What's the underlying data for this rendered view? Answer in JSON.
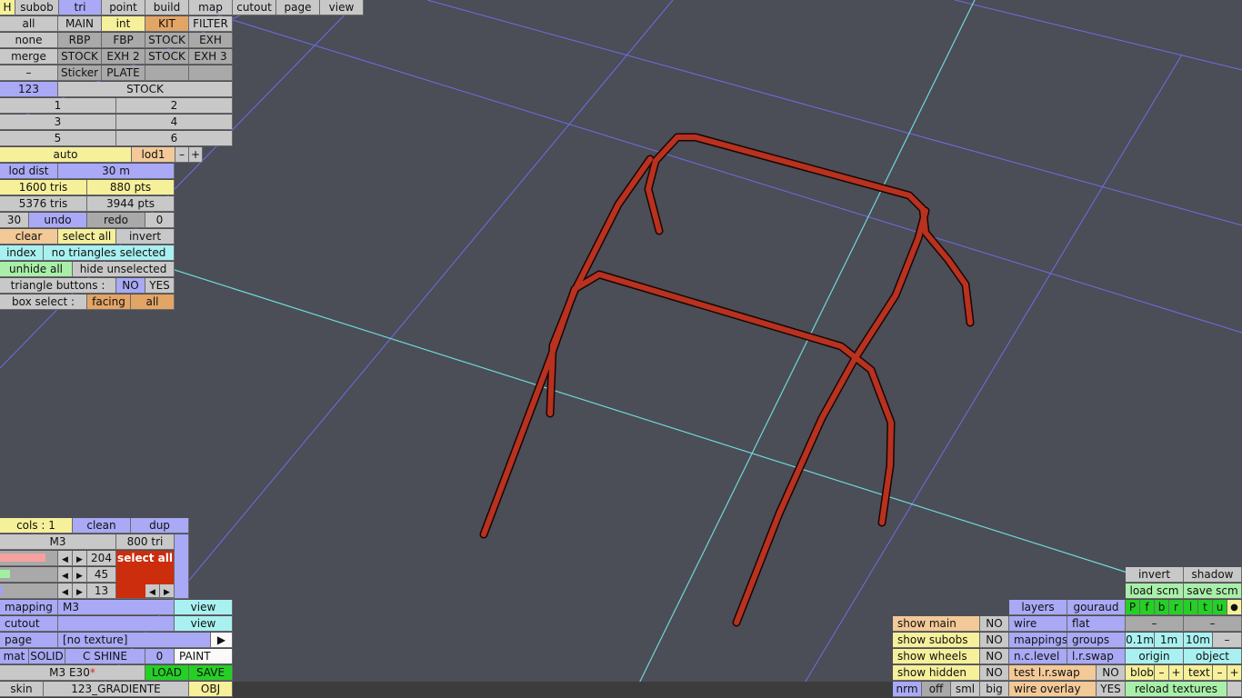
{
  "top_menu": {
    "h": "H",
    "subob": "subob",
    "tri": "tri",
    "point": "point",
    "build": "build",
    "map": "map",
    "cutout": "cutout",
    "page": "page",
    "view": "view"
  },
  "parts": {
    "all": "all",
    "none": "none",
    "merge": "merge",
    "dash": "–",
    "row1": [
      "MAIN",
      "int",
      "KIT",
      "FILTER"
    ],
    "row2": [
      "RBP",
      "FBP",
      "STOCK",
      "EXH"
    ],
    "row3": [
      "STOCK",
      "EXH 2",
      "STOCK",
      "EXH 3"
    ],
    "row4": [
      "Sticker",
      "PLATE",
      "",
      ""
    ]
  },
  "variant": {
    "num": "123",
    "name": "STOCK",
    "slots": [
      "1",
      "2",
      "3",
      "4",
      "5",
      "6"
    ]
  },
  "lod": {
    "auto": "auto",
    "lod1": "lod1",
    "minus": "–",
    "plus": "+",
    "lod_dist_label": "lod dist",
    "lod_dist_value": "30 m",
    "tris": "1600 tris",
    "pts": "880 pts",
    "total_tris": "5376 tris",
    "total_pts": "3944 pts"
  },
  "history": {
    "count": "30",
    "undo": "undo",
    "redo": "redo",
    "redo_count": "0"
  },
  "selection": {
    "clear": "clear",
    "select_all": "select all",
    "invert": "invert",
    "index": "index",
    "status": "no triangles selected",
    "unhide_all": "unhide all",
    "hide_unselected": "hide unselected",
    "tri_buttons_label": "triangle buttons :",
    "no": "NO",
    "yes": "YES",
    "box_select_label": "box select :",
    "facing": "facing",
    "all": "all"
  },
  "material": {
    "cols": "cols : 1",
    "clean": "clean",
    "dup": "dup",
    "name": "M3",
    "tri_count": "800 tri",
    "r": "204",
    "g": "45",
    "b": "13",
    "r_fill": 0.8,
    "g_fill": 0.18,
    "b_fill": 0.05,
    "select_all": "select all",
    "swatch_color": "#cc2d0d",
    "mapping_label": "mapping",
    "mapping_value": "M3",
    "view1": "view",
    "cutout_label": "cutout",
    "cutout_value": "",
    "view2": "view",
    "page_label": "page",
    "page_value": "[no texture]",
    "page_arrow": "▶",
    "mat": "mat",
    "solid": "SOLID",
    "c_shine": "C SHINE",
    "zero": "0",
    "paint": "PAINT",
    "file": "M3 E30",
    "file_mark": "*",
    "load": "LOAD",
    "save": "SAVE",
    "skin_label": "skin",
    "skin_value": "123_GRADIENTE",
    "obj": "OBJ"
  },
  "display": {
    "show_main": "show main",
    "show_subobs": "show subobs",
    "show_wheels": "show wheels",
    "show_hidden": "show hidden",
    "no": "NO",
    "nrm": "nrm",
    "off": "off",
    "sml": "sml",
    "big": "big",
    "layers": "layers",
    "gouraud": "gouraud",
    "wire": "wire",
    "flat": "flat",
    "mappings": "mappings",
    "groups": "groups",
    "nclevel": "n.c.level",
    "lrswap": "l.r.swap",
    "test_lrswap": "test l.r.swap",
    "wire_overlay": "wire overlay",
    "yes": "YES",
    "invert": "invert",
    "shadow": "shadow",
    "load_scm": "load scm",
    "save_scm": "save scm",
    "letters": [
      "P",
      "f",
      "b",
      "r",
      "l",
      "t",
      "u",
      "●"
    ],
    "dash": "–",
    "g01": "0.1m",
    "g1": "1m",
    "g10": "10m",
    "origin": "origin",
    "object": "object",
    "blob": "blob",
    "text": "text",
    "minus": "–",
    "plus": "+",
    "reload_textures": "reload textures"
  },
  "colors": {
    "viewport_bg": "#4b4d57",
    "grid": "#6b6bd8",
    "axis": "#6fd8d8",
    "tube": "#b8321f"
  }
}
